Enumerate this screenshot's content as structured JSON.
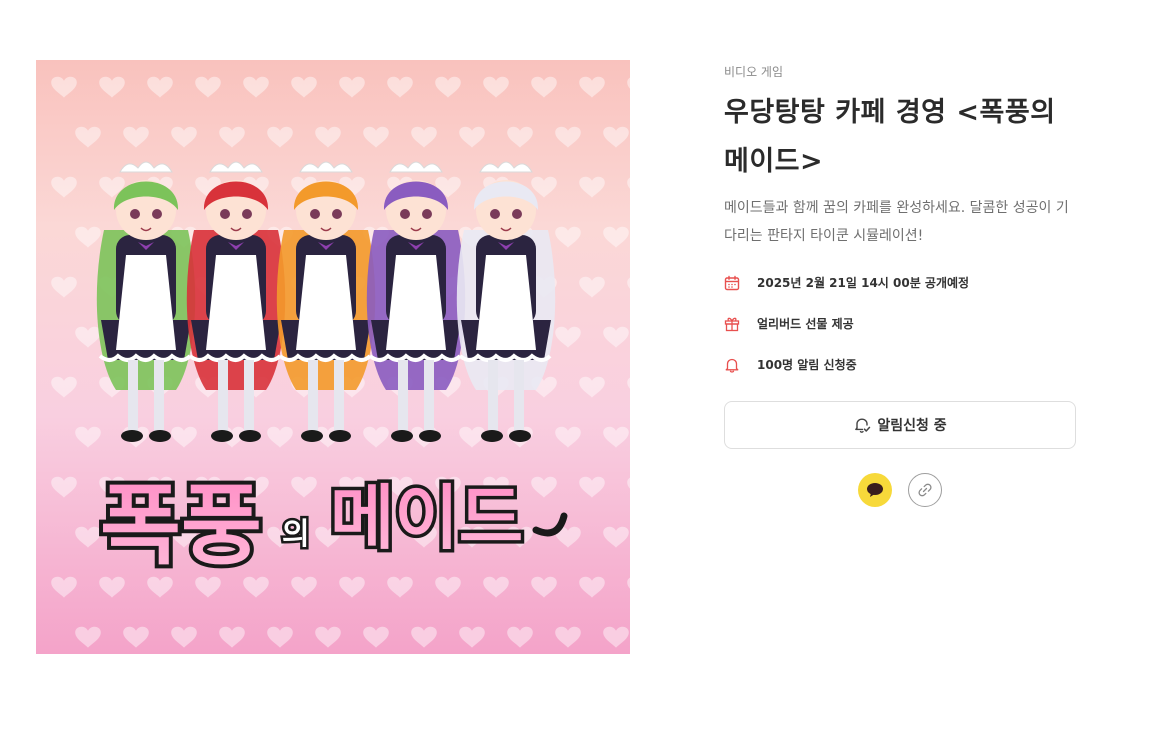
{
  "product": {
    "category": "비디오 게임",
    "title": "우당탕탕 카페 경영 <폭풍의 메이드>",
    "description": "메이드들과 함께 꿈의 카페를 완성하세요. 달콤한 성공이 기다리는 판타지 타이쿤 시뮬레이션!"
  },
  "cover": {
    "logo_part1": "폭풍",
    "logo_part2": "의",
    "logo_part3": "메이드",
    "character_hair_colors": [
      "#7cc35a",
      "#d8323a",
      "#f39a2b",
      "#8a5cc0",
      "#e9e9f3"
    ]
  },
  "facts": [
    {
      "icon": "calendar-icon",
      "text": "2025년 2월 21일 14시 00분 공개예정"
    },
    {
      "icon": "gift-icon",
      "text": "얼리버드 선물 제공"
    },
    {
      "icon": "bell-icon",
      "text": "100명 알림 신청중"
    }
  ],
  "notify_button": {
    "icon": "bell-check-icon",
    "label": "알림신청 중"
  },
  "share": [
    {
      "icon": "kakao-talk-icon",
      "color": "#f7d93a"
    },
    {
      "icon": "link-icon",
      "color": "#ffffff"
    }
  ],
  "colors": {
    "accent": "#e8504f",
    "title": "#2b2b2b",
    "kakao": "#f7d93a"
  }
}
